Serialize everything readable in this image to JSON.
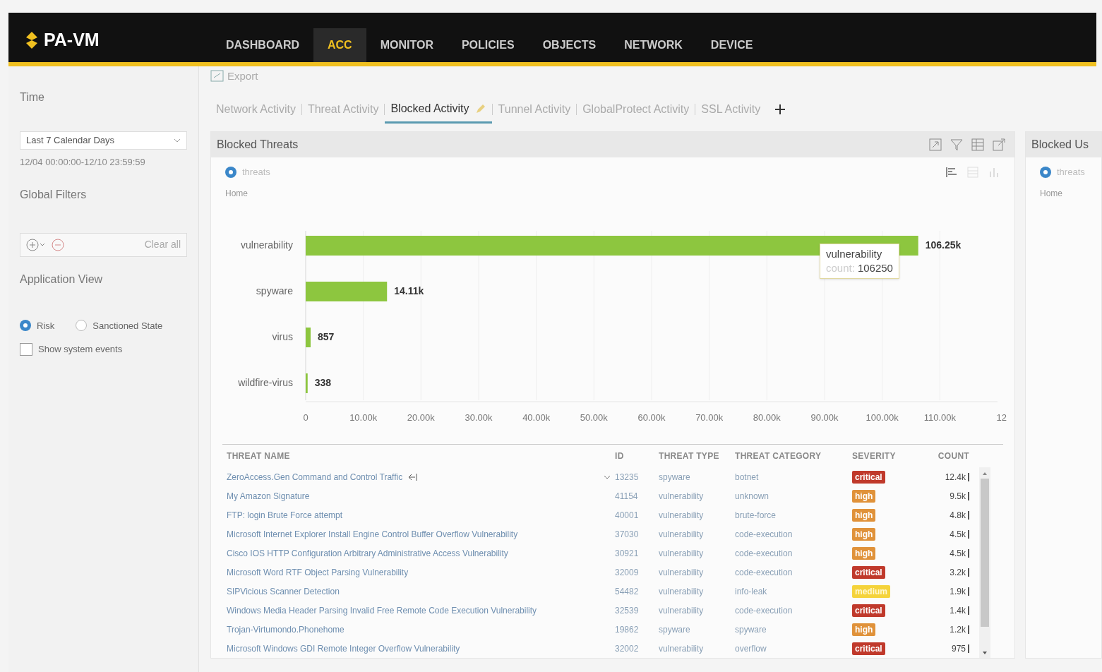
{
  "header": {
    "logo": "PA-VM",
    "nav": [
      {
        "label": "DASHBOARD",
        "selected": false
      },
      {
        "label": "ACC",
        "selected": true
      },
      {
        "label": "MONITOR",
        "selected": false
      },
      {
        "label": "POLICIES",
        "selected": false
      },
      {
        "label": "OBJECTS",
        "selected": false
      },
      {
        "label": "NETWORK",
        "selected": false
      },
      {
        "label": "DEVICE",
        "selected": false
      }
    ]
  },
  "sidebar": {
    "time_title": "Time",
    "time_range": "Last 7 Calendar Days",
    "time_span": "12/04 00:00:00-12/10 23:59:59",
    "filters_title": "Global Filters",
    "clear_all": "Clear all",
    "app_view_title": "Application View",
    "radios": [
      {
        "label": "Risk",
        "selected": true
      },
      {
        "label": "Sanctioned State",
        "selected": false
      }
    ],
    "show_system_events": {
      "label": "Show system events",
      "checked": false
    }
  },
  "toolbar": {
    "export": "Export"
  },
  "tabs": [
    {
      "label": "Network Activity",
      "selected": false
    },
    {
      "label": "Threat Activity",
      "selected": false
    },
    {
      "label": "Blocked Activity",
      "selected": true
    },
    {
      "label": "Tunnel Activity",
      "selected": false
    },
    {
      "label": "GlobalProtect Activity",
      "selected": false
    },
    {
      "label": "SSL Activity",
      "selected": false
    }
  ],
  "widget": {
    "title": "Blocked Threats",
    "radio": {
      "selected": true
    },
    "breadcrumb": "Home",
    "chart_data": {
      "type": "bar",
      "orientation": "horizontal",
      "categories": [
        "vulnerability",
        "spyware",
        "virus",
        "wildfire-virus"
      ],
      "series": [
        {
          "name": "threats",
          "color": "#8dc63f",
          "values": [
            106250,
            14110,
            857,
            338
          ]
        }
      ],
      "value_labels": [
        "106.25k",
        "14.11k",
        "857",
        "338"
      ],
      "xlim": [
        0,
        120000
      ],
      "grid": true,
      "xticks": [
        {
          "value": 0,
          "label": "0"
        },
        {
          "value": 10000,
          "label": "10.00k"
        },
        {
          "value": 20000,
          "label": "20.00k"
        },
        {
          "value": 30000,
          "label": "30.00k"
        },
        {
          "value": 40000,
          "label": "40.00k"
        },
        {
          "value": 50000,
          "label": "50.00k"
        },
        {
          "value": 60000,
          "label": "60.00k"
        },
        {
          "value": 70000,
          "label": "70.00k"
        },
        {
          "value": 80000,
          "label": "80.00k"
        },
        {
          "value": 90000,
          "label": "90.00k"
        },
        {
          "value": 100000,
          "label": "100.00k"
        },
        {
          "value": 110000,
          "label": "110.00k"
        }
      ]
    },
    "axis_end_fragment": "12",
    "tooltip": {
      "title": "vulnerability",
      "key": "count:",
      "value": "106250"
    },
    "table": {
      "columns": [
        "THREAT NAME",
        "ID",
        "THREAT TYPE",
        "THREAT CATEGORY",
        "SEVERITY",
        "COUNT"
      ],
      "rows": [
        {
          "name": "ZeroAccess.Gen Command and Control Traffic",
          "id": "13235",
          "type": "spyware",
          "category": "botnet",
          "severity": "critical",
          "count": "12.4k"
        },
        {
          "name": "My Amazon Signature",
          "id": "41154",
          "type": "vulnerability",
          "category": "unknown",
          "severity": "high",
          "count": "9.5k"
        },
        {
          "name": "FTP: login Brute Force attempt",
          "id": "40001",
          "type": "vulnerability",
          "category": "brute-force",
          "severity": "high",
          "count": "4.8k"
        },
        {
          "name": "Microsoft Internet Explorer Install Engine Control Buffer Overflow Vulnerability",
          "id": "37030",
          "type": "vulnerability",
          "category": "code-execution",
          "severity": "high",
          "count": "4.5k"
        },
        {
          "name": "Cisco IOS HTTP Configuration Arbitrary Administrative Access Vulnerability",
          "id": "30921",
          "type": "vulnerability",
          "category": "code-execution",
          "severity": "high",
          "count": "4.5k"
        },
        {
          "name": "Microsoft Word RTF Object Parsing Vulnerability",
          "id": "32009",
          "type": "vulnerability",
          "category": "code-execution",
          "severity": "critical",
          "count": "3.2k"
        },
        {
          "name": "SIPVicious Scanner Detection",
          "id": "54482",
          "type": "vulnerability",
          "category": "info-leak",
          "severity": "medium",
          "count": "1.9k"
        },
        {
          "name": "Windows Media Header Parsing Invalid Free Remote Code Execution Vulnerability",
          "id": "32539",
          "type": "vulnerability",
          "category": "code-execution",
          "severity": "critical",
          "count": "1.4k"
        },
        {
          "name": "Trojan-Virtumondo.Phonehome",
          "id": "19862",
          "type": "spyware",
          "category": "spyware",
          "severity": "high",
          "count": "1.2k"
        },
        {
          "name": "Microsoft Windows GDI Remote Integer Overflow Vulnerability",
          "id": "32002",
          "type": "vulnerability",
          "category": "overflow",
          "severity": "critical",
          "count": "975"
        }
      ]
    }
  },
  "side_widget": {
    "title": "Blocked Us",
    "radio": {
      "label": "threats",
      "selected": true
    },
    "breadcrumb": "Home"
  }
}
